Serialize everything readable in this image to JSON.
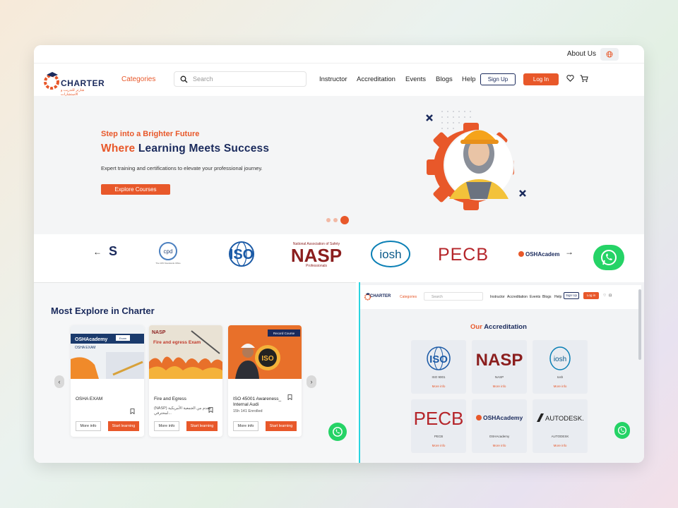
{
  "topbar": {
    "about": "About Us"
  },
  "brand": {
    "name": "CHARTER",
    "tagline": "شارتر للتدريب و الاستشارات"
  },
  "nav": {
    "categories": "Categories",
    "search_placeholder": "Search",
    "links": [
      "Instructor",
      "Accreditation",
      "Events",
      "Blogs",
      "Help"
    ],
    "signup": "Sign Up",
    "login": "Log In"
  },
  "hero": {
    "tagline": "Step into a Brighter Future",
    "title_highlight": "Where",
    "title_rest": "Learning Meets Success",
    "description": "Expert training and certifications to elevate your professional journey.",
    "button": "Explore Courses"
  },
  "partners": [
    "cpd",
    "ISO",
    "NASP",
    "iosh",
    "PECB",
    "OSHAcademy"
  ],
  "partner_sub": {
    "cpd": "The CPD Standards Office",
    "nasp_top": "National Association of Safety",
    "nasp_bottom": "Professionals"
  },
  "explore": {
    "title": "Most Explore in Charter",
    "cards": [
      {
        "title": "OSHA EXAM",
        "sub": "",
        "meta": "",
        "img_badge": "OSHAcademy",
        "img_caption": "OSHA EXAM",
        "img_tag": "Exam"
      },
      {
        "title": "Fire and Egress",
        "sub": "(NASP) مقدم من الجمعية الأمريكية لمحترفي...",
        "meta": "",
        "img_badge": "NASP",
        "img_caption": "Fire and egress Exam",
        "img_tag": ""
      },
      {
        "title": "ISO 45001 Awareness_ Internal Audi",
        "sub": "",
        "meta": "15h   141 Enrolled",
        "img_badge": "",
        "img_caption": "ISO",
        "img_tag": "Record Course"
      }
    ],
    "more_info": "More info",
    "start": "Start learning"
  },
  "mini": {
    "brand": "CHARTER",
    "categories": "Categories",
    "search": "Search",
    "links": [
      "Instructor",
      "Accreditation",
      "Events",
      "Blogs",
      "Help"
    ],
    "signup": "Sign Up",
    "login": "Log in"
  },
  "accreditation": {
    "title_highlight": "Our",
    "title_rest": "Accreditation",
    "more_info": "More info",
    "items": [
      {
        "logo": "ISO",
        "name": "ISO 9001"
      },
      {
        "logo": "NASP",
        "name": "NASP"
      },
      {
        "logo": "iosh",
        "name": "Iosh"
      },
      {
        "logo": "PECB",
        "name": "PECB"
      },
      {
        "logo": "OSHAcademy",
        "name": "OSHAcademy"
      },
      {
        "logo": "AUTODESK.",
        "name": "AUTODESK"
      }
    ]
  },
  "colors": {
    "accent": "#e8582a",
    "navy": "#1a2a5c",
    "whatsapp": "#25d366",
    "hero_bg": "#f4f5f6"
  }
}
